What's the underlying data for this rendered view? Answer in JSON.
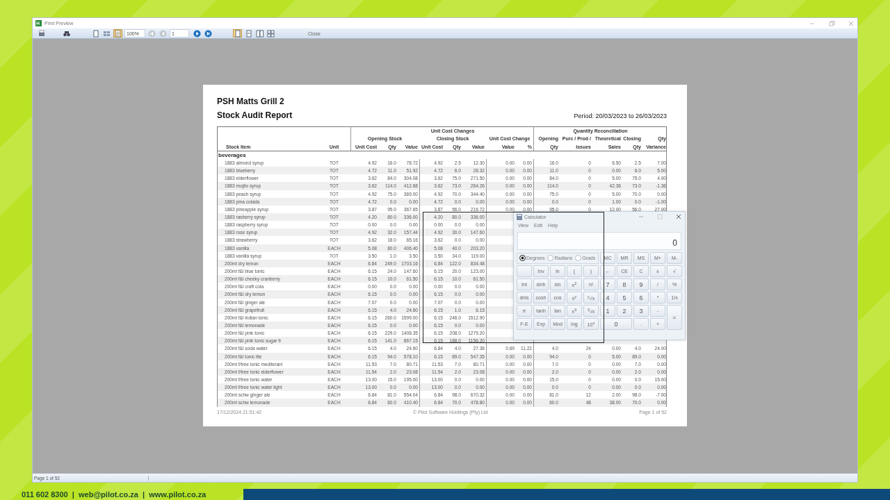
{
  "window": {
    "title": "Print Preview"
  },
  "toolbar": {
    "zoom": "100%",
    "page": "1",
    "close": "Close",
    "tools": [
      {
        "kind": "print",
        "selected": false
      },
      {
        "kind": "find",
        "selected": false
      }
    ],
    "layout_tools": [
      {
        "kind": "page",
        "selected": false
      },
      {
        "kind": "thumbs",
        "selected": false
      },
      {
        "kind": "setup",
        "selected": true
      }
    ],
    "nav": [
      {
        "kind": "first",
        "disabled": true
      },
      {
        "kind": "prev",
        "disabled": true
      },
      {
        "kind": "next",
        "disabled": false
      },
      {
        "kind": "last",
        "disabled": false
      }
    ],
    "views": [
      {
        "kind": "one",
        "selected": true
      },
      {
        "kind": "scroll",
        "selected": false
      },
      {
        "kind": "two",
        "selected": false
      },
      {
        "kind": "four",
        "selected": false
      }
    ]
  },
  "report": {
    "company": "PSH Matts Grill 2",
    "title": "Stock Audit Report",
    "period": "Period: 20/03/2023 to 26/03/2023",
    "group_headers": [
      "Unit Cost Changes",
      "Quantity Reconciliation"
    ],
    "sub_headers": [
      "Opening Stock",
      "Closing Stock",
      "Unit Cost Change",
      "Opening",
      "Purc / Prod /",
      "Theoretical",
      "Closing",
      "Qty"
    ],
    "columns": [
      "Stock Item",
      "Unit",
      "Unit Cost",
      "Qty",
      "Value",
      "Unit Cost",
      "Qty",
      "Value",
      "Value",
      "%",
      "Qty",
      "Issues",
      "Sales",
      "Qty",
      "Variance"
    ],
    "category": "beverages",
    "rows": [
      [
        "1883 almond syrup",
        "TOT",
        "4.92",
        "16.0",
        "78.72",
        "4.92",
        "2.5",
        "12.30",
        "0.00",
        "0.00",
        "16.0",
        "0",
        "6.50",
        "2.5",
        "7.00"
      ],
      [
        "1883 blueberry",
        "TOT",
        "4.72",
        "11.0",
        "51.92",
        "4.72",
        "6.0",
        "28.32",
        "0.00",
        "0.00",
        "11.0",
        "0",
        "0.00",
        "6.0",
        "5.00"
      ],
      [
        "1883 elderflower",
        "TOT",
        "3.62",
        "84.0",
        "304.08",
        "3.62",
        "75.0",
        "271.50",
        "0.00",
        "0.00",
        "84.0",
        "0",
        "5.00",
        "75.0",
        "4.00"
      ],
      [
        "1883 mojito syrup",
        "TOT",
        "3.62",
        "114.0",
        "412.68",
        "3.62",
        "73.0",
        "264.26",
        "0.00",
        "0.00",
        "114.0",
        "0",
        "42.36",
        "73.0",
        "-1.36"
      ],
      [
        "1883 peach syrup",
        "TOT",
        "4.92",
        "75.0",
        "369.00",
        "4.92",
        "70.0",
        "344.40",
        "0.00",
        "0.00",
        "75.0",
        "0",
        "5.00",
        "70.0",
        "0.00"
      ],
      [
        "1883 pina colada",
        "TOT",
        "4.72",
        "0.0",
        "0.00",
        "4.72",
        "0.0",
        "0.00",
        "0.00",
        "0.00",
        "0.0",
        "0",
        "1.00",
        "0.0",
        "-1.00"
      ],
      [
        "1883 pineapple syrup",
        "TOT",
        "3.87",
        "95.0",
        "367.65",
        "3.87",
        "56.0",
        "216.72",
        "0.00",
        "0.00",
        "95.0",
        "0",
        "12.00",
        "56.0",
        "27.00"
      ],
      [
        "1883 rasberry syrup",
        "TOT",
        "4.20",
        "80.0",
        "336.00",
        "4.20",
        "80.0",
        "336.00"
      ],
      [
        "1883 raspberry syrup",
        "TOT",
        "0.00",
        "0.0",
        "0.00",
        "0.00",
        "0.0",
        "0.00"
      ],
      [
        "1883 rose syrup",
        "TOT",
        "4.92",
        "32.0",
        "157.44",
        "4.92",
        "30.0",
        "147.60"
      ],
      [
        "1883 strawberry",
        "TOT",
        "3.62",
        "18.0",
        "65.16",
        "3.62",
        "0.0",
        "0.00"
      ],
      [
        "1883 vanilla",
        "EACH",
        "5.08",
        "80.0",
        "406.40",
        "5.08",
        "40.0",
        "203.20"
      ],
      [
        "1883 vanilla syrup",
        "TOT",
        "3.50",
        "1.0",
        "3.50",
        "3.50",
        "34.0",
        "119.00"
      ],
      [
        "200ml dry lemon",
        "EACH",
        "6.84",
        "249.0",
        "1703.16",
        "6.84",
        "122.0",
        "834.48"
      ],
      [
        "200ml f&l blue tonic",
        "EACH",
        "6.15",
        "24.0",
        "147.60",
        "6.15",
        "20.0",
        "123.00"
      ],
      [
        "200ml f&l cheeky cranberry",
        "EACH",
        "6.15",
        "10.0",
        "61.50",
        "6.15",
        "10.0",
        "61.50"
      ],
      [
        "200ml f&l craft cola",
        "EACH",
        "0.00",
        "0.0",
        "0.00",
        "0.00",
        "0.0",
        "0.00"
      ],
      [
        "200ml f&l dry lemon",
        "EACH",
        "6.15",
        "0.0",
        "0.00",
        "6.15",
        "0.0",
        "0.00"
      ],
      [
        "200ml f&l ginger ale",
        "EACH",
        "7.07",
        "0.0",
        "0.00",
        "7.07",
        "0.0",
        "0.00"
      ],
      [
        "200ml f&l grapefruit",
        "EACH",
        "6.15",
        "4.0",
        "24.60",
        "6.15",
        "1.0",
        "6.15"
      ],
      [
        "200ml f&l indian tonic",
        "EACH",
        "6.15",
        "260.0",
        "1599.00",
        "6.15",
        "246.0",
        "1512.90"
      ],
      [
        "200ml f&l lemonade",
        "EACH",
        "6.15",
        "0.0",
        "0.00",
        "6.15",
        "0.0",
        "0.00"
      ],
      [
        "200ml f&l pink tonic",
        "EACH",
        "6.15",
        "229.0",
        "1408.35",
        "6.15",
        "208.0",
        "1279.20"
      ],
      [
        "200ml f&l pink tonic sugar fr",
        "EACH",
        "6.15",
        "141.0",
        "867.15",
        "6.15",
        "188.0",
        "1156.20"
      ],
      [
        "200ml f&l soda water",
        "EACH",
        "6.15",
        "4.0",
        "24.60",
        "6.84",
        "4.0",
        "27.36",
        "0.69",
        "11.22",
        "4.0",
        "24",
        "0.00",
        "4.0",
        "24.00"
      ],
      [
        "200ml f&l tonic lite",
        "EACH",
        "6.15",
        "94.0",
        "578.10",
        "6.15",
        "89.0",
        "547.35",
        "0.00",
        "0.00",
        "94.0",
        "0",
        "5.00",
        "89.0",
        "0.00"
      ],
      [
        "200ml f/tree tonic mediterani",
        "EACH",
        "11.53",
        "7.0",
        "80.71",
        "11.53",
        "7.0",
        "80.71",
        "0.00",
        "0.00",
        "7.0",
        "0",
        "0.00",
        "7.0",
        "0.00"
      ],
      [
        "200ml f/tree tonic elderflower",
        "EACH",
        "11.54",
        "2.0",
        "23.08",
        "11.54",
        "2.0",
        "23.08",
        "0.00",
        "0.00",
        "2.0",
        "0",
        "0.00",
        "2.0",
        "0.00"
      ],
      [
        "200ml f/tree tonic water",
        "EACH",
        "13.00",
        "15.0",
        "195.00",
        "13.00",
        "0.0",
        "0.00",
        "0.00",
        "0.00",
        "15.0",
        "0",
        "0.00",
        "0.0",
        "15.00"
      ],
      [
        "200ml f/tree tonic water light",
        "EACH",
        "13.00",
        "0.0",
        "0.00",
        "13.00",
        "0.0",
        "0.00",
        "0.00",
        "0.00",
        "0.0",
        "0",
        "0.00",
        "0.0",
        "0.00"
      ],
      [
        "200ml schw ginger ale",
        "EACH",
        "6.84",
        "81.0",
        "554.04",
        "6.84",
        "98.0",
        "670.32",
        "0.00",
        "0.00",
        "81.0",
        "12",
        "2.00",
        "98.0",
        "-7.00"
      ],
      [
        "200ml schw lemonade",
        "EACH",
        "6.84",
        "60.0",
        "410.40",
        "6.84",
        "70.0",
        "478.80",
        "0.00",
        "0.00",
        "60.0",
        "48",
        "38.00",
        "70.0",
        "0.00"
      ]
    ],
    "footer": {
      "printed": "17/12/2024 21:51:42",
      "copyright": "© Pilot Software Holdings (Pty) Ltd",
      "page": "Page 1 of 52"
    }
  },
  "calculator": {
    "title": "Calculator",
    "menu": [
      "View",
      "Edit",
      "Help"
    ],
    "display": "0",
    "angle_modes": [
      {
        "label": "Degrees",
        "selected": true
      },
      {
        "label": "Radians",
        "selected": false
      },
      {
        "label": "Grads",
        "selected": false
      }
    ],
    "memory": [
      "MC",
      "MR",
      "MS",
      "M+",
      "M-"
    ],
    "keys": [
      {
        "kind": "blank"
      },
      {
        "kind": "fn",
        "label": "Inv"
      },
      {
        "kind": "fn",
        "label": "ln"
      },
      {
        "kind": "fn",
        "label": "("
      },
      {
        "kind": "fn",
        "label": ")"
      },
      {
        "kind": "key",
        "label": "←"
      },
      {
        "kind": "key",
        "label": "CE"
      },
      {
        "kind": "key",
        "label": "C"
      },
      {
        "kind": "key",
        "label": "±"
      },
      {
        "kind": "key",
        "label": "√"
      },
      {
        "kind": "fn",
        "label": "Int"
      },
      {
        "kind": "fn",
        "label": "sinh"
      },
      {
        "kind": "fn",
        "label": "sin"
      },
      {
        "kind": "fn",
        "label": "x$^{2}$"
      },
      {
        "kind": "fn",
        "label": "n!"
      },
      {
        "kind": "digit",
        "label": "7"
      },
      {
        "kind": "digit",
        "label": "8"
      },
      {
        "kind": "digit",
        "label": "9"
      },
      {
        "kind": "key",
        "label": "/"
      },
      {
        "kind": "key",
        "label": "%"
      },
      {
        "kind": "fn",
        "label": "dms"
      },
      {
        "kind": "fn",
        "label": "cosh"
      },
      {
        "kind": "fn",
        "label": "cos"
      },
      {
        "kind": "fn",
        "label": "x$^{y}$"
      },
      {
        "kind": "fn",
        "label": "$^{y}$√x"
      },
      {
        "kind": "digit",
        "label": "4"
      },
      {
        "kind": "digit",
        "label": "5"
      },
      {
        "kind": "digit",
        "label": "6"
      },
      {
        "kind": "key",
        "label": "*"
      },
      {
        "kind": "key",
        "label": "1/x"
      },
      {
        "kind": "fn",
        "label": "π"
      },
      {
        "kind": "fn",
        "label": "tanh"
      },
      {
        "kind": "fn",
        "label": "tan"
      },
      {
        "kind": "fn",
        "label": "x$^{3}$"
      },
      {
        "kind": "fn",
        "label": "$^{3}$√x"
      },
      {
        "kind": "digit",
        "label": "1"
      },
      {
        "kind": "digit",
        "label": "2"
      },
      {
        "kind": "digit",
        "label": "3"
      },
      {
        "kind": "key",
        "label": "-"
      },
      {
        "kind": "tall",
        "label": "="
      },
      {
        "kind": "fn",
        "label": "F-E"
      },
      {
        "kind": "fn",
        "label": "Exp"
      },
      {
        "kind": "fn",
        "label": "Mod"
      },
      {
        "kind": "fn",
        "label": "log"
      },
      {
        "kind": "fn",
        "label": "10$^{x}$"
      },
      {
        "kind": "wide",
        "label": "0"
      },
      {
        "kind": "key",
        "label": "."
      },
      {
        "kind": "key",
        "label": "+"
      }
    ]
  },
  "status_bar": {
    "page": "Page 1 of 52"
  },
  "banner": {
    "contact": "011 602 8300  |  web@pilot.co.za  |  www.pilot.co.za"
  }
}
